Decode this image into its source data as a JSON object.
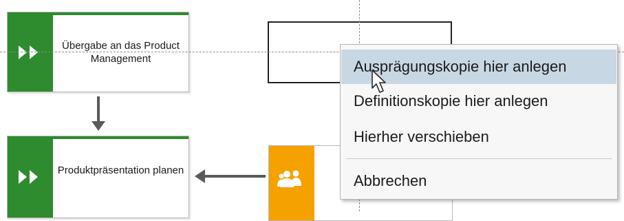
{
  "colors": {
    "function_green": "#2e8b2e",
    "org_orange": "#f5a100",
    "menu_highlight": "#c8d7e4",
    "connector_gray": "#5a5a5a"
  },
  "diagram": {
    "function_1": {
      "label": "Übergabe an das Product Management",
      "icon": "double-chevron-icon"
    },
    "function_2": {
      "label": "Produktpräsentation planen",
      "icon": "double-chevron-icon"
    },
    "org_unit": {
      "icon": "people-group-icon"
    }
  },
  "context_menu": {
    "items": [
      {
        "label": "Ausprägungskopie hier anlegen",
        "highlighted": true
      },
      {
        "label": "Definitionskopie hier anlegen",
        "highlighted": false
      },
      {
        "label": "Hierher verschieben",
        "highlighted": false
      },
      {
        "label": "Abbrechen",
        "highlighted": false
      }
    ]
  }
}
